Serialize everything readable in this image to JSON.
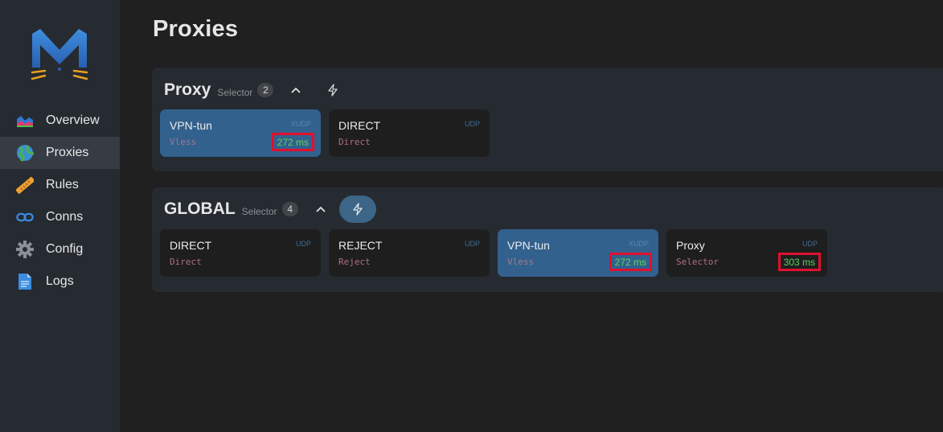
{
  "sidebar": {
    "items": [
      {
        "label": "Overview",
        "icon": "chart-area-icon"
      },
      {
        "label": "Proxies",
        "icon": "globe-icon",
        "active": true
      },
      {
        "label": "Rules",
        "icon": "ruler-icon"
      },
      {
        "label": "Conns",
        "icon": "link-icon"
      },
      {
        "label": "Config",
        "icon": "gear-icon"
      },
      {
        "label": "Logs",
        "icon": "document-icon"
      }
    ]
  },
  "page": {
    "title": "Proxies"
  },
  "groups": [
    {
      "name": "Proxy",
      "type": "Selector",
      "count": "2",
      "proxies": [
        {
          "name": "VPN-tun",
          "type": "Vless",
          "udp": "XUDP",
          "latency": "272 ms",
          "selected": true
        },
        {
          "name": "DIRECT",
          "type": "Direct",
          "udp": "UDP",
          "latency": "",
          "selected": false
        }
      ]
    },
    {
      "name": "GLOBAL",
      "type": "Selector",
      "count": "4",
      "proxies": [
        {
          "name": "DIRECT",
          "type": "Direct",
          "udp": "UDP",
          "latency": "",
          "selected": false
        },
        {
          "name": "REJECT",
          "type": "Reject",
          "udp": "UDP",
          "latency": "",
          "selected": false
        },
        {
          "name": "VPN-tun",
          "type": "Vless",
          "udp": "XUDP",
          "latency": "272 ms",
          "selected": true
        },
        {
          "name": "Proxy",
          "type": "Selector",
          "udp": "UDP",
          "latency": "303 ms",
          "selected": false
        }
      ]
    }
  ],
  "colors": {
    "sidebar_bg": "#262a31",
    "page_bg": "#202020",
    "selected_card": "#33618d",
    "latency_good": "#5fd45f",
    "highlight_border": "#e0102e"
  }
}
